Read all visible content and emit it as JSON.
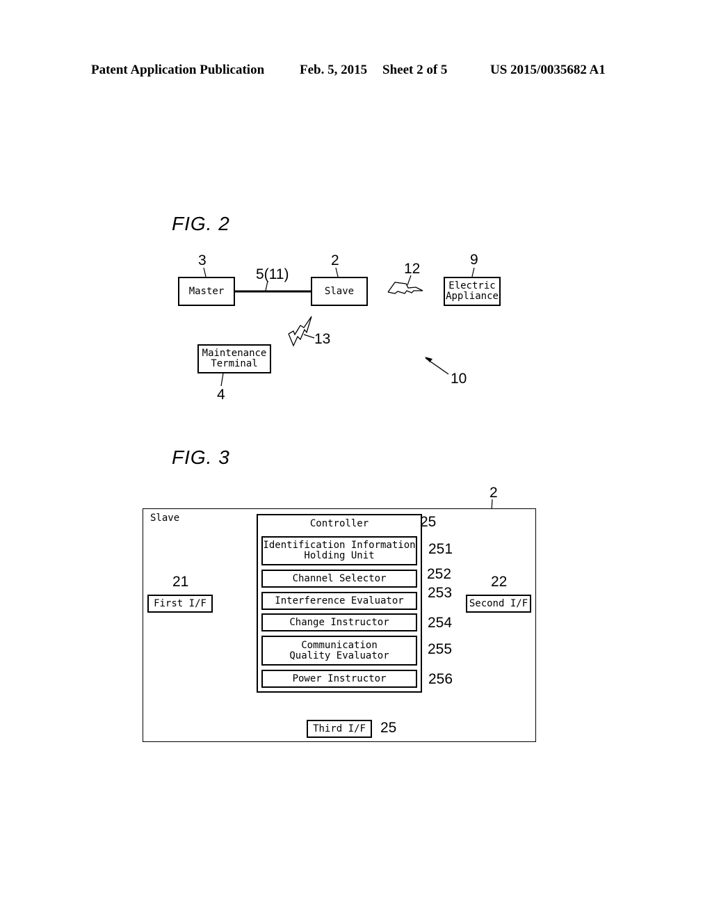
{
  "header": {
    "publication": "Patent Application Publication",
    "date": "Feb. 5, 2015",
    "sheet": "Sheet 2 of 5",
    "number": "US 2015/0035682 A1"
  },
  "fig2": {
    "title": "FIG. 2",
    "master": {
      "label": "Master",
      "ref": "3"
    },
    "slave": {
      "label": "Slave",
      "ref": "2"
    },
    "link": {
      "ref": "5(11)"
    },
    "wireless_appliance": {
      "ref": "12"
    },
    "appliance": {
      "label": "Electric\nAppliance",
      "ref": "9"
    },
    "wireless_maintenance": {
      "ref": "13"
    },
    "maintenance": {
      "label": "Maintenance\nTerminal",
      "ref": "4"
    },
    "system": {
      "ref": "10"
    }
  },
  "fig3": {
    "title": "FIG. 3",
    "slave": {
      "label": "Slave",
      "ref": "2"
    },
    "controller": {
      "label": "Controller",
      "ref": "25"
    },
    "units": [
      {
        "label": "Identification Information\nHolding Unit",
        "ref": "251"
      },
      {
        "label": "Channel Selector",
        "ref": "252"
      },
      {
        "label": "Interference Evaluator",
        "ref": "253"
      },
      {
        "label": "Change Instructor",
        "ref": "254"
      },
      {
        "label": "Communication\nQuality Evaluator",
        "ref": "255"
      },
      {
        "label": "Power Instructor",
        "ref": "256"
      }
    ],
    "first_if": {
      "label": "First I/F",
      "ref": "21"
    },
    "second_if": {
      "label": "Second I/F",
      "ref": "22"
    },
    "third_if": {
      "label": "Third I/F",
      "ref": "25"
    }
  }
}
